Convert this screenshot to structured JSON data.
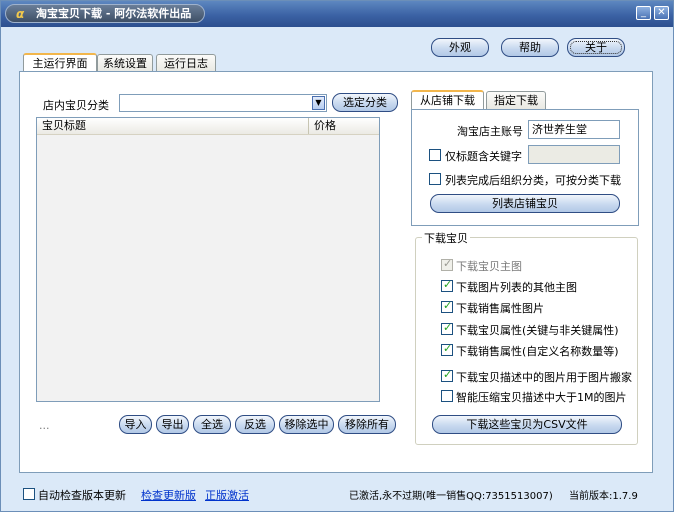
{
  "window": {
    "title": "淘宝宝贝下载 - 阿尔法软件出品",
    "logo_char": "α",
    "minimize_glyph": "_",
    "close_glyph": "✕"
  },
  "top_buttons": {
    "skin": "外观",
    "help": "帮助",
    "about": "关于"
  },
  "tabs": [
    {
      "label": "主运行界面",
      "active": true
    },
    {
      "label": "系统设置",
      "active": false
    },
    {
      "label": "运行日志",
      "active": false
    }
  ],
  "category": {
    "label": "店内宝贝分类",
    "value": "",
    "dropdown_glyph": "▼",
    "select_button": "选定分类"
  },
  "item_list": {
    "columns": [
      "宝贝标题",
      "价格"
    ],
    "ellipsis": "..."
  },
  "bottom_buttons": [
    "导入",
    "导出",
    "全选",
    "反选",
    "移除选中",
    "移除所有"
  ],
  "source_tabs": [
    {
      "label": "从店铺下载",
      "active": true
    },
    {
      "label": "指定下载",
      "active": false
    }
  ],
  "store_panel": {
    "account_label": "淘宝店主账号",
    "account_value": "济世养生堂",
    "keyword_label": "仅标题含关键字",
    "keyword_checked": false,
    "keyword_value": "",
    "organize_label": "列表完成后组织分类，可按分类下载",
    "organize_checked": false,
    "list_button": "列表店铺宝贝"
  },
  "download_group": {
    "title": "下载宝贝",
    "options": [
      {
        "label": "下载宝贝主图",
        "checked": true,
        "disabled": true
      },
      {
        "label": "下载图片列表的其他主图",
        "checked": true,
        "disabled": false
      },
      {
        "label": "下载销售属性图片",
        "checked": true,
        "disabled": false
      },
      {
        "label": "下载宝贝属性(关键与非关键属性)",
        "checked": true,
        "disabled": false
      },
      {
        "label": "下载销售属性(自定义名称数量等)",
        "checked": true,
        "disabled": false
      },
      {
        "label": "下载宝贝描述中的图片用于图片搬家",
        "checked": true,
        "disabled": false
      },
      {
        "label": "智能压缩宝贝描述中大于1M的图片",
        "checked": false,
        "disabled": false
      }
    ],
    "export_button": "下载这些宝贝为CSV文件"
  },
  "status_bar": {
    "auto_update_label": "自动检查版本更新",
    "auto_update_checked": false,
    "check_update_link": "检查更新版",
    "activate_link": "正版激活",
    "license_text": "已激活,永不过期(唯一销售QQ:7351513007)",
    "version_text": "当前版本:1.7.9"
  },
  "colors": {
    "window_bg": "#dbe9f8",
    "titlebar": "#3b62a4",
    "link": "#0033cc",
    "check": "#21a121"
  }
}
